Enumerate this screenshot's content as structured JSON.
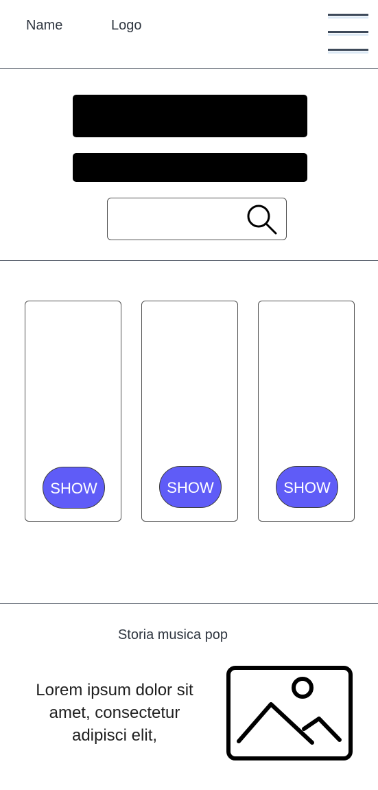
{
  "header": {
    "name_label": "Name",
    "logo_label": "Logo",
    "menu_icon": "hamburger-menu-icon"
  },
  "hero": {
    "search": {
      "placeholder": "",
      "icon": "search-icon"
    }
  },
  "cards": [
    {
      "button_label": "SHOW"
    },
    {
      "button_label": "SHOW"
    },
    {
      "button_label": "SHOW"
    }
  ],
  "section": {
    "title": "Storia musica pop",
    "body": "Lorem ipsum dolor sit amet, consectetur adipisci elit,",
    "image_icon": "image-placeholder-icon"
  },
  "colors": {
    "button_bg": "#5f5cf7",
    "button_text": "#ffffff",
    "bar": "#000000",
    "divider": "#5d6470"
  }
}
